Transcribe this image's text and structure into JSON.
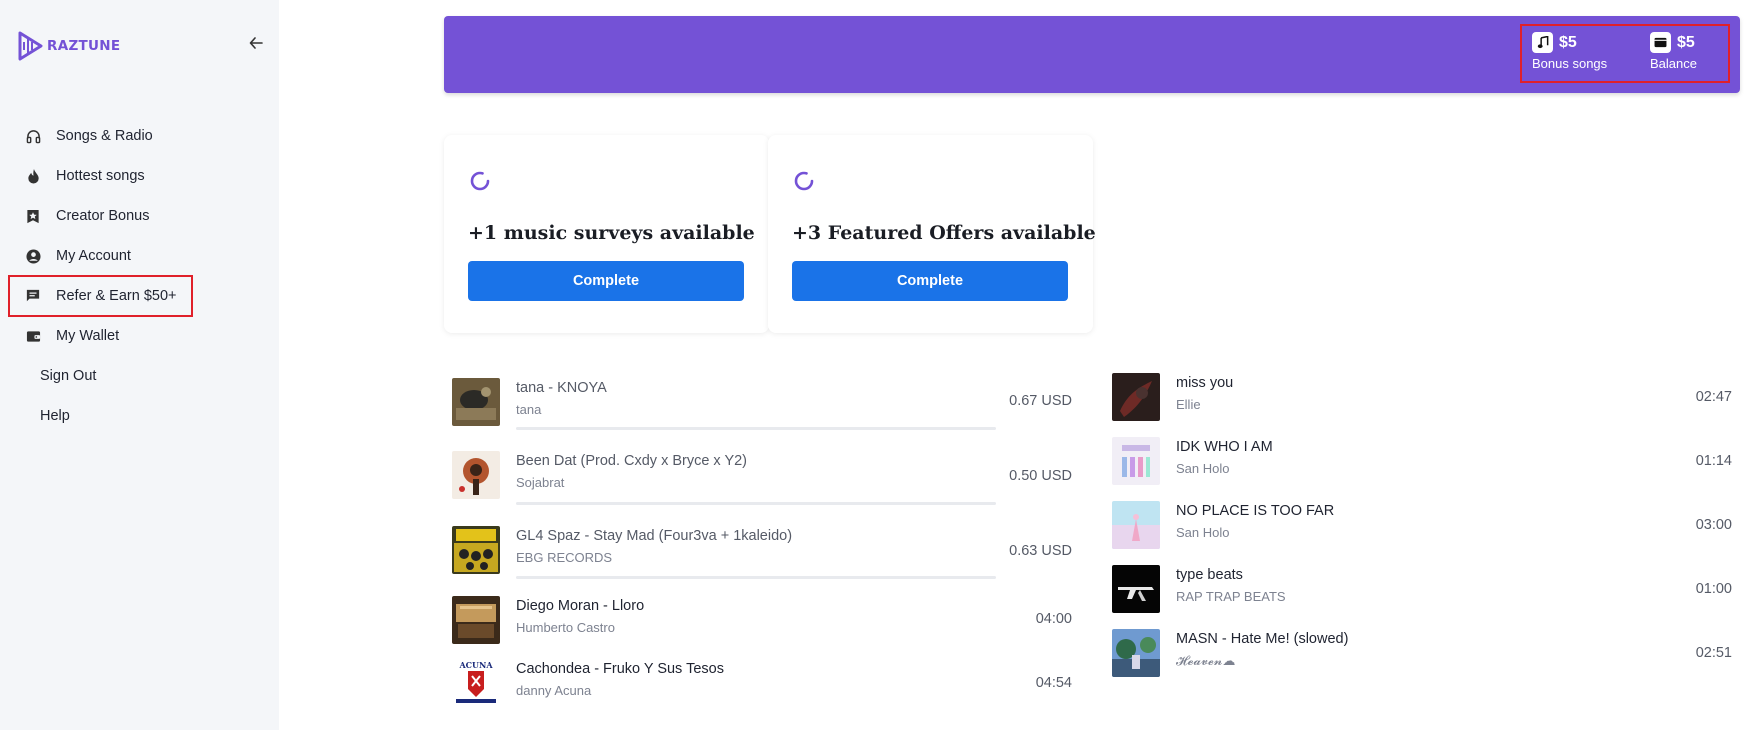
{
  "app": {
    "logo_text": "RAZTUNE",
    "brand_color": "#7452d6",
    "accent_color": "#1a73e8",
    "highlight_color": "#e0202a"
  },
  "sidebar": {
    "items": [
      {
        "label": "Songs & Radio",
        "icon": "headphones-icon"
      },
      {
        "label": "Hottest songs",
        "icon": "flame-icon"
      },
      {
        "label": "Creator Bonus",
        "icon": "star-badge-icon"
      },
      {
        "label": "My Account",
        "icon": "user-circle-icon"
      },
      {
        "label": "Refer & Earn $50+",
        "icon": "chat-icon"
      },
      {
        "label": "My Wallet",
        "icon": "wallet-icon"
      },
      {
        "label": "Sign Out"
      },
      {
        "label": "Help"
      }
    ]
  },
  "banner": {
    "bonus": {
      "value": "$5",
      "label": "Bonus songs",
      "icon": "music-note-icon"
    },
    "balance": {
      "value": "$5",
      "label": "Balance",
      "icon": "wallet-icon"
    }
  },
  "cards": [
    {
      "title": "+1 music surveys available",
      "button": "Complete",
      "icon": "loading-spinner-icon"
    },
    {
      "title": "+3 Featured Offers available",
      "button": "Complete",
      "icon": "loading-spinner-icon"
    }
  ],
  "left_songs": [
    {
      "title": "tana - KNOYA",
      "artist": "tana",
      "value": "0.67 USD"
    },
    {
      "title": "Been Dat (Prod. Cxdy x Bryce x Y2)",
      "artist": "Sojabrat",
      "value": "0.50 USD"
    },
    {
      "title": "GL4 Spaz - Stay Mad (Four3va + 1kaleido)",
      "artist": "EBG RECORDS",
      "value": "0.63 USD"
    },
    {
      "title": "Diego Moran - Lloro",
      "artist": "Humberto Castro",
      "value": "04:00"
    },
    {
      "title": "Cachondea - Fruko Y Sus Tesos",
      "artist": "danny Acuna",
      "value": "04:54"
    }
  ],
  "right_songs": [
    {
      "title": "miss you",
      "artist": "Ellie",
      "value": "02:47"
    },
    {
      "title": "IDK WHO I AM",
      "artist": "San Holo",
      "value": "01:14"
    },
    {
      "title": "NO PLACE IS TOO FAR",
      "artist": "San Holo",
      "value": "03:00"
    },
    {
      "title": "type beats",
      "artist": "RAP TRAP BEATS",
      "value": "01:00"
    },
    {
      "title": "MASN - Hate Me! (slowed)",
      "artist": "𝓗𝓮𝓪𝓿𝓮𝓷☁",
      "value": "02:51"
    }
  ]
}
